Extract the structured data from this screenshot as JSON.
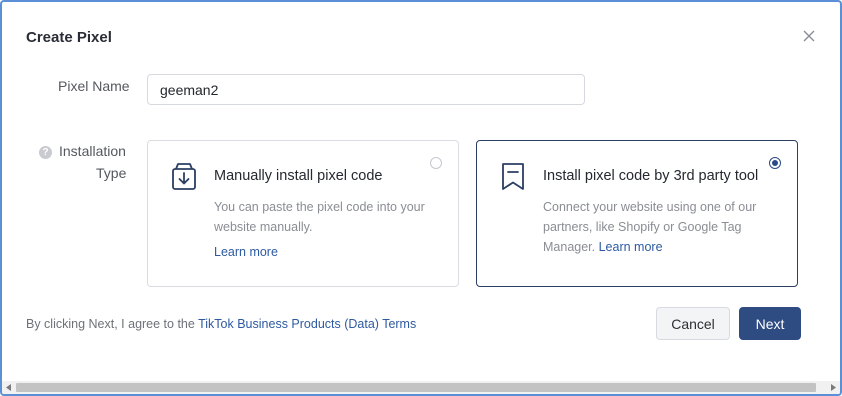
{
  "dialog": {
    "title": "Create Pixel",
    "close_icon": "close-icon"
  },
  "form": {
    "pixel_name_label": "Pixel Name",
    "pixel_name_value": "geeman2",
    "installation_type_label_line1": "Installation",
    "installation_type_label_line2": "Type",
    "help_icon": "question-circle-icon",
    "help_glyph": "?"
  },
  "options": [
    {
      "icon": "download-box-icon",
      "title": "Manually install pixel code",
      "description": "You can paste the pixel code into your website manually.",
      "link": "Learn more",
      "selected": false
    },
    {
      "icon": "bookmark-icon",
      "title": "Install pixel code by 3rd party tool",
      "description": "Connect your website using one of our partners, like Shopify or Google Tag Manager.",
      "link": "Learn more",
      "selected": true
    }
  ],
  "footer": {
    "agreement_prefix": "By clicking Next, I agree to the",
    "terms_link": "TikTok Business Products (Data) Terms",
    "cancel_label": "Cancel",
    "next_label": "Next"
  },
  "colors": {
    "primary": "#2e4b82",
    "link": "#2d5aa0",
    "selected_border": "#2b3e63",
    "frame_border": "#5b8fd6"
  }
}
